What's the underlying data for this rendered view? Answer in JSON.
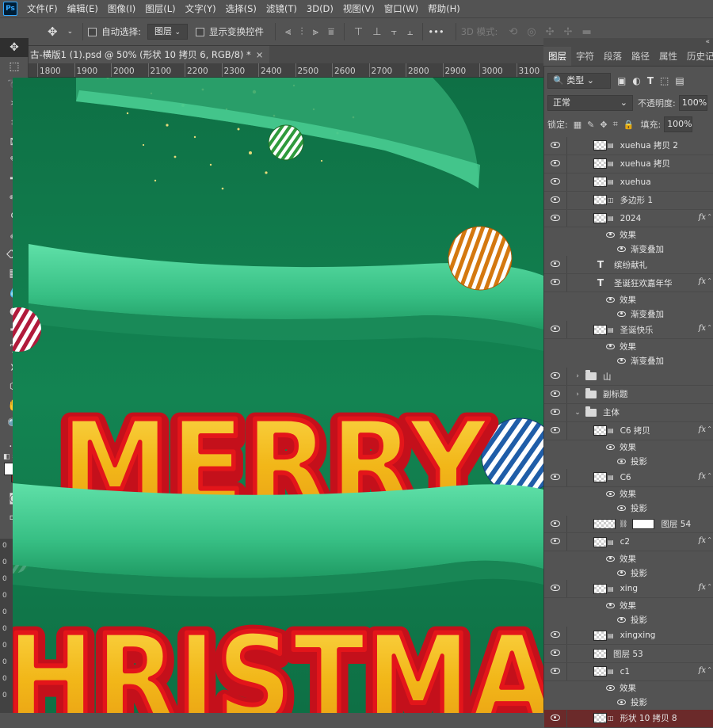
{
  "menu": {
    "logo": "Ps",
    "items": [
      "文件(F)",
      "编辑(E)",
      "图像(I)",
      "图层(L)",
      "文字(Y)",
      "选择(S)",
      "滤镜(T)",
      "3D(D)",
      "视图(V)",
      "窗口(W)",
      "帮助(H)"
    ]
  },
  "options": {
    "auto_select_label": "自动选择:",
    "auto_select_value": "图层",
    "show_transform_label": "显示变换控件",
    "more": "•••",
    "mode_3d_label": "3D 模式:"
  },
  "document": {
    "tab_title": "古-横版1 (1).psd @ 50% (形状 10 拷贝 6, RGB/8) *",
    "close": "×"
  },
  "ruler": {
    "ticks": [
      "1800",
      "1900",
      "2000",
      "2100",
      "2200",
      "2300",
      "2400",
      "2500",
      "2600",
      "2700",
      "2800",
      "2900",
      "3000",
      "3100"
    ],
    "left_ticks": [
      "0",
      "0",
      "0",
      "0",
      "0",
      "0",
      "0",
      "0",
      "0",
      "0"
    ]
  },
  "canvas": {
    "word1": "MERRY",
    "word2": "HRISTMA",
    "colors": {
      "bg": "#127a4a",
      "ribbon": "#3ecb8e",
      "text_fill": "#f5c51f",
      "text_outline": "#e3151a"
    }
  },
  "panels": {
    "collapse_icon": "«",
    "tabs": [
      "图层",
      "字符",
      "段落",
      "路径",
      "属性",
      "历史记"
    ],
    "active_tab": "图层",
    "filter_kind": "类型",
    "blend_mode": "正常",
    "opacity_label": "不透明度:",
    "opacity_value": "100%",
    "lock_label": "锁定:",
    "fill_label": "填充:",
    "fill_value": "100%"
  },
  "layers": [
    {
      "type": "smart",
      "name": "xuehua 拷贝 2",
      "indent": 1
    },
    {
      "type": "smart",
      "name": "xuehua 拷贝",
      "indent": 1
    },
    {
      "type": "smart",
      "name": "xuehua",
      "indent": 1
    },
    {
      "type": "shape",
      "name": "多边形 1",
      "indent": 1
    },
    {
      "type": "smart",
      "name": "2024",
      "indent": 1,
      "fx": true
    },
    {
      "type": "effects",
      "name": "效果",
      "indent": 2
    },
    {
      "type": "effect",
      "name": "渐变叠加",
      "indent": 3
    },
    {
      "type": "text",
      "name": "缤纷献礼",
      "indent": 1
    },
    {
      "type": "text",
      "name": "圣诞狂欢嘉年华",
      "indent": 1,
      "fx": true
    },
    {
      "type": "effects",
      "name": "效果",
      "indent": 2
    },
    {
      "type": "effect",
      "name": "渐变叠加",
      "indent": 3
    },
    {
      "type": "smart",
      "name": "圣诞快乐",
      "indent": 1,
      "fx": true
    },
    {
      "type": "effects",
      "name": "效果",
      "indent": 2
    },
    {
      "type": "effect",
      "name": "渐变叠加",
      "indent": 3
    },
    {
      "type": "folder",
      "name": "山",
      "indent": 0,
      "open": false
    },
    {
      "type": "folder",
      "name": "副标题",
      "indent": 0,
      "open": false
    },
    {
      "type": "folder",
      "name": "主体",
      "indent": 0,
      "open": true
    },
    {
      "type": "smart",
      "name": "C6 拷贝",
      "indent": 1,
      "fx": true
    },
    {
      "type": "effects",
      "name": "效果",
      "indent": 2
    },
    {
      "type": "effect",
      "name": "投影",
      "indent": 3
    },
    {
      "type": "smart",
      "name": "C6",
      "indent": 1,
      "fx": true
    },
    {
      "type": "effects",
      "name": "效果",
      "indent": 2
    },
    {
      "type": "effect",
      "name": "投影",
      "indent": 3
    },
    {
      "type": "masked",
      "name": "图层 54",
      "indent": 1
    },
    {
      "type": "smart",
      "name": "c2",
      "indent": 1,
      "fx": true
    },
    {
      "type": "effects",
      "name": "效果",
      "indent": 2
    },
    {
      "type": "effect",
      "name": "投影",
      "indent": 3
    },
    {
      "type": "smart",
      "name": "xing",
      "indent": 1,
      "fx": true
    },
    {
      "type": "effects",
      "name": "效果",
      "indent": 2
    },
    {
      "type": "effect",
      "name": "投影",
      "indent": 3
    },
    {
      "type": "smart",
      "name": "xingxing",
      "indent": 1
    },
    {
      "type": "pixel",
      "name": "图层 53",
      "indent": 1
    },
    {
      "type": "smart",
      "name": "c1",
      "indent": 1,
      "fx": true
    },
    {
      "type": "effects",
      "name": "效果",
      "indent": 2
    },
    {
      "type": "effect",
      "name": "投影",
      "indent": 3
    },
    {
      "type": "shape",
      "name": "形状 10 拷贝 8",
      "indent": 1,
      "selected": true
    }
  ]
}
